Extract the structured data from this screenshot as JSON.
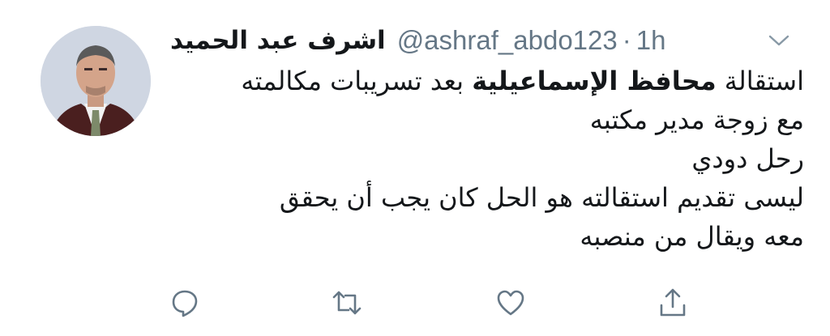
{
  "tweet": {
    "display_name": "اشرف عبد الحميد",
    "handle": "@ashraf_abdo123",
    "separator": "·",
    "time": "1h",
    "lines": [
      {
        "before": "استقالة ",
        "bold": "محافظ الإسماعيلية",
        "after": " بعد تسريبات مكالمته"
      },
      {
        "text": "مع زوجة مدير مكتبه"
      },
      {
        "text": "رحل دودي"
      },
      {
        "text": "ليسى تقديم استقالته هو الحل كان يجب أن يحقق"
      },
      {
        "text": "معه ويقال من منصبه"
      }
    ]
  },
  "icons": {
    "caret": "chevron-down-icon",
    "reply": "reply-icon",
    "retweet": "retweet-icon",
    "like": "heart-icon",
    "share": "share-icon"
  },
  "colors": {
    "text": "#14171a",
    "secondary": "#657786",
    "icon": "#657786"
  }
}
